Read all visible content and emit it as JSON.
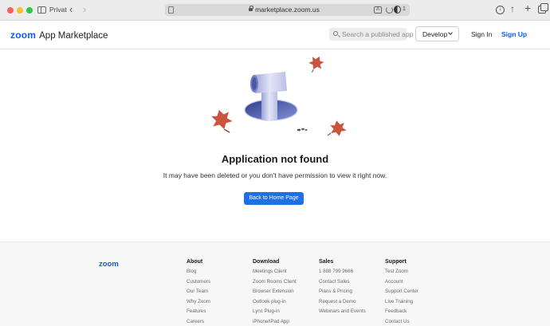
{
  "browser": {
    "tab_group": "Privat",
    "url": "marketplace.zoom.us",
    "extension_count": "1"
  },
  "header": {
    "logo": "zoom",
    "app_name": "App Marketplace",
    "search_placeholder": "Search a published app",
    "develop_label": "Develop",
    "sign_in": "Sign In",
    "sign_up": "Sign Up"
  },
  "main": {
    "title": "Application not found",
    "message": "It may have been deleted or you don't have permission to view it right now.",
    "home_button": "Back to Home Page"
  },
  "footer": {
    "logo": "zoom",
    "columns": [
      {
        "title": "About",
        "links": [
          "Blog",
          "Customers",
          "Our Team",
          "Why Zoom",
          "Features",
          "Careers"
        ]
      },
      {
        "title": "Download",
        "links": [
          "Meetings Client",
          "Zoom Rooms Client",
          "Browser Extension",
          "Outlook plug-in",
          "Lync Plug-in",
          "iPhone/iPad App"
        ]
      },
      {
        "title": "Sales",
        "links": [
          "1 888 799 9666",
          "Contact Sales",
          "Plans & Pricing",
          "Request a Demo",
          "Webinars and Events"
        ]
      },
      {
        "title": "Support",
        "links": [
          "Test Zoom",
          "Account",
          "Support Center",
          "Live Training",
          "Feedback",
          "Contact Us"
        ]
      }
    ]
  },
  "colors": {
    "brand_blue": "#0b5cff",
    "button_blue": "#1f6fe5",
    "leaf": "#c9553f"
  },
  "icons": [
    "sidebar-icon",
    "chevron-left-icon",
    "chevron-right-icon",
    "lock-icon",
    "translate-icon",
    "reload-icon",
    "shield-icon",
    "download-icon",
    "share-icon",
    "plus-icon",
    "tabs-icon",
    "search-icon",
    "chevron-down-icon",
    "leaf-icon"
  ]
}
